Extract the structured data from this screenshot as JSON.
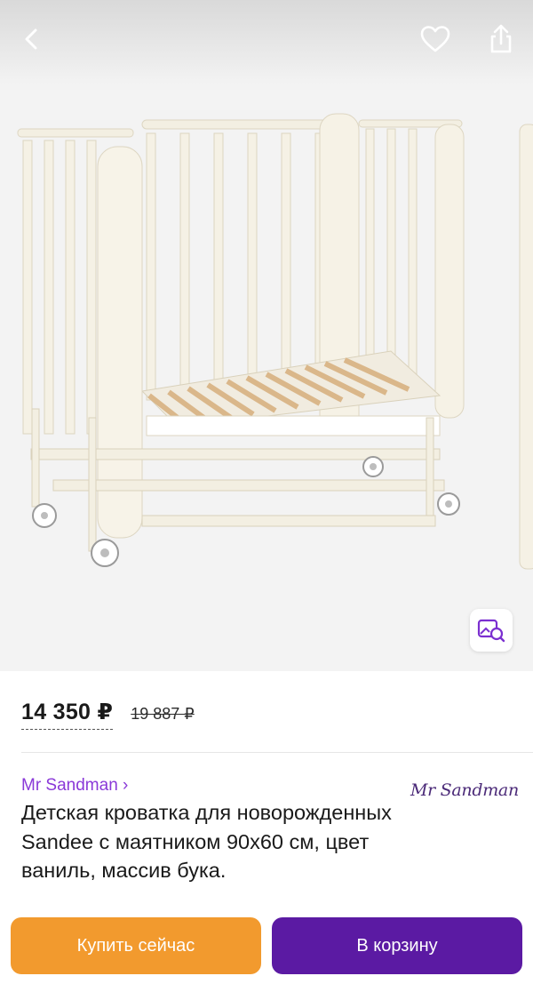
{
  "header": {
    "back_icon": "chevron-left-icon",
    "favorite_icon": "heart-icon",
    "share_icon": "share-icon"
  },
  "gallery": {
    "image_alt": "white baby crib with wooden slats and wheels",
    "visual_search_icon": "visual-search-icon"
  },
  "price": {
    "current": "14 350 ₽",
    "old": "19 887 ₽"
  },
  "seller": {
    "link": "Mr Sandman ›",
    "logo_text": "Mr Sandman"
  },
  "product": {
    "title": "Детская кроватка для новорожденных Sandee с маятником 90х60 см, цвет ваниль, массив бука."
  },
  "actions": {
    "buy_now": "Купить сейчас",
    "add_to_cart": "В корзину"
  },
  "colors": {
    "buy_now_bg": "#f29a2e",
    "add_to_cart_bg": "#5b1aa3",
    "seller_link": "#8a39d8"
  }
}
